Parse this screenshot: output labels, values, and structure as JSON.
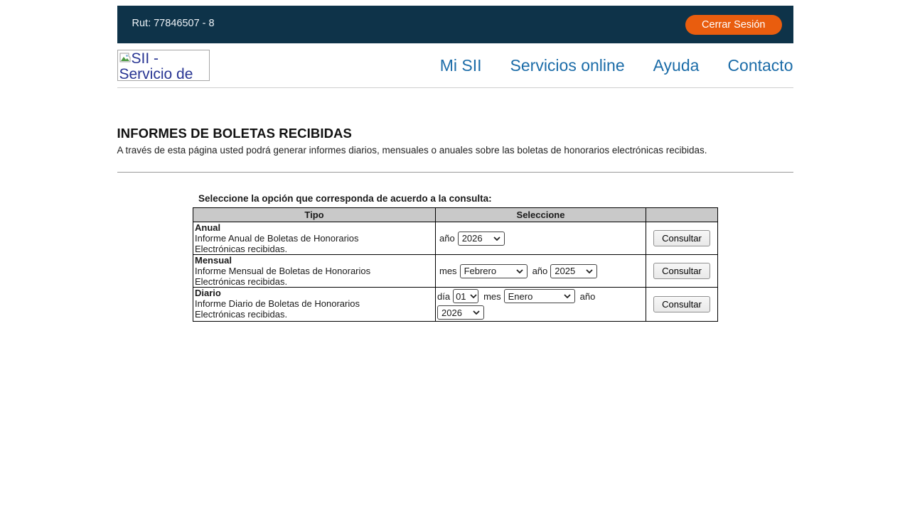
{
  "topbar": {
    "rut_label": "Rut: 77846507 - 8",
    "logout_label": "Cerrar Sesión"
  },
  "header": {
    "logo_alt": "SII - Servicio de",
    "nav": [
      {
        "label": "Mi SII"
      },
      {
        "label": "Servicios online"
      },
      {
        "label": "Ayuda"
      },
      {
        "label": "Contacto"
      }
    ]
  },
  "main": {
    "title": "INFORMES DE BOLETAS RECIBIDAS",
    "description": "A través de esta página usted podrá generar informes diarios, mensuales o anuales sobre las boletas de honorarios electrónicas recibidas.",
    "prompt": "Seleccione la opción que corresponda de acuerdo a la consulta:",
    "table": {
      "headers": [
        "Tipo",
        "Seleccione",
        ""
      ],
      "rows": [
        {
          "type": "Anual",
          "description": "Informe Anual de Boletas de Honorarios Electrónicas recibidas.",
          "fields": [
            {
              "label": "año",
              "value": "2026"
            }
          ],
          "button": "Consultar"
        },
        {
          "type": "Mensual",
          "description": "Informe Mensual de Boletas de Honorarios Electrónicas recibidas.",
          "fields": [
            {
              "label": "mes",
              "value": "Febrero"
            },
            {
              "label": "año",
              "value": "2025"
            }
          ],
          "button": "Consultar"
        },
        {
          "type": "Diario",
          "description": "Informe Diario de Boletas de Honorarios Electrónicas recibidas.",
          "fields": [
            {
              "label": "día",
              "value": "01"
            },
            {
              "label": "mes",
              "value": "Enero"
            },
            {
              "label": "año",
              "value": "2026"
            }
          ],
          "button": "Consultar"
        }
      ]
    }
  },
  "colors": {
    "topbar_bg": "#0e3349",
    "logout_bg": "#e95d0e",
    "nav_link": "#1b6ca8",
    "logo_alt_text": "#283593",
    "table_header_bg": "#c9c9c9"
  }
}
